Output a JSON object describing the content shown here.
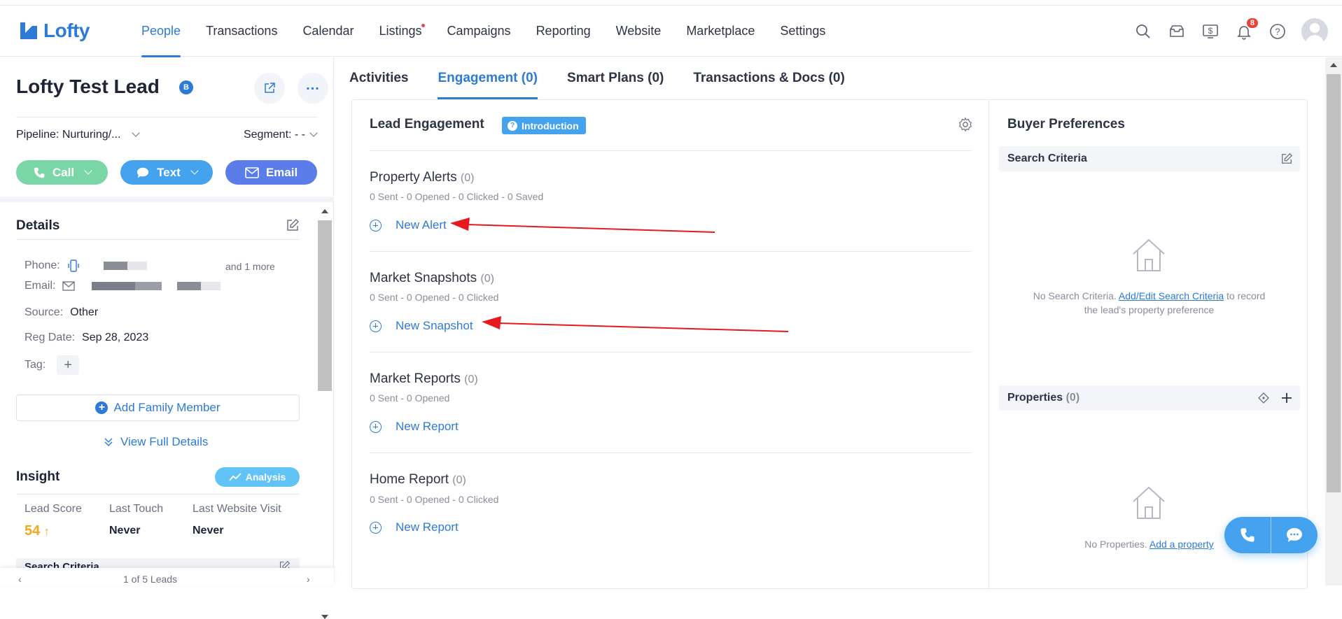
{
  "brand": {
    "name": "Lofty",
    "color": "#2d7ad7"
  },
  "nav": {
    "items": [
      "People",
      "Transactions",
      "Calendar",
      "Listings",
      "Campaigns",
      "Reporting",
      "Website",
      "Marketplace",
      "Settings"
    ],
    "active": "People"
  },
  "header_icons": {
    "icons": [
      "search-icon",
      "inbox-icon",
      "dollar-icon",
      "bell-icon",
      "help-icon",
      "avatar"
    ],
    "notification_count": "8"
  },
  "lead": {
    "name": "Lofty Test Lead",
    "badge": "B",
    "pipeline": "Pipeline: Nurturing/...",
    "segment": "Segment: - -",
    "actions": {
      "call": "Call",
      "text": "Text",
      "email": "Email"
    }
  },
  "details": {
    "title": "Details",
    "phone_label": "Phone:",
    "phone_more": "and 1 more",
    "email_label": "Email:",
    "source_label": "Source:",
    "source_value": "Other",
    "reg_label": "Reg Date:",
    "reg_value": "Sep 28, 2023",
    "tag_label": "Tag:",
    "add_family": "Add Family Member",
    "view_full": "View Full Details"
  },
  "insight": {
    "title": "Insight",
    "analysis": "Analysis",
    "lead_score_label": "Lead Score",
    "lead_score": "54",
    "last_touch_label": "Last Touch",
    "last_touch": "Never",
    "last_visit_label": "Last Website Visit",
    "last_visit": "Never",
    "search_criteria": "Search Criteria"
  },
  "footer": {
    "pager": "1 of 5 Leads"
  },
  "tabs": [
    "Activities",
    "Engagement (0)",
    "Smart Plans (0)",
    "Transactions & Docs (0)"
  ],
  "active_tab": "Engagement (0)",
  "engagement": {
    "title": "Lead Engagement",
    "intro_label": "Introduction",
    "sections": [
      {
        "title": "Property Alerts",
        "count": "(0)",
        "stats": "0 Sent - 0 Opened - 0 Clicked - 0 Saved",
        "action": "New Alert"
      },
      {
        "title": "Market Snapshots",
        "count": "(0)",
        "stats": "0 Sent - 0 Opened - 0 Clicked",
        "action": "New Snapshot"
      },
      {
        "title": "Market Reports",
        "count": "(0)",
        "stats": "0 Sent - 0 Opened",
        "action": "New Report"
      },
      {
        "title": "Home Report",
        "count": "(0)",
        "stats": "0 Sent - 0 Opened - 0 Clicked",
        "action": "New Report"
      }
    ]
  },
  "buyer": {
    "title": "Buyer Preferences",
    "criteria_label": "Search Criteria",
    "criteria_empty_pre": "No Search Criteria.",
    "criteria_empty_link": "Add/Edit Search Criteria",
    "criteria_empty_post": "to record",
    "criteria_empty_line2": "the lead's property preference",
    "properties_label": "Properties",
    "properties_count": "(0)",
    "properties_empty_pre": "No Properties.",
    "properties_empty_link": "Add a property"
  },
  "colors": {
    "accent": "#2d7ad7",
    "call": "#7ad6a6",
    "text": "#44a2ef",
    "email": "#5b7de9",
    "annotation_arrow": "#e8191c"
  }
}
